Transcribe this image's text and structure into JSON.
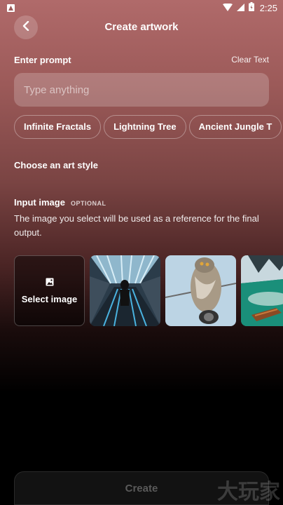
{
  "status_bar": {
    "time": "2:25"
  },
  "header": {
    "title": "Create artwork"
  },
  "prompt": {
    "label": "Enter prompt",
    "clear_label": "Clear Text",
    "placeholder": "Type anything",
    "suggestions": [
      "Infinite Fractals",
      "Lightning Tree",
      "Ancient Jungle T"
    ]
  },
  "art_style": {
    "label": "Choose an art style"
  },
  "input_image": {
    "label": "Input image",
    "optional_label": "OPTIONAL",
    "description": "The image you select will be used as a reference for the final output.",
    "select_label": "Select image"
  },
  "create_button": {
    "label": "Create"
  },
  "watermark": {
    "text": "大玩家"
  }
}
